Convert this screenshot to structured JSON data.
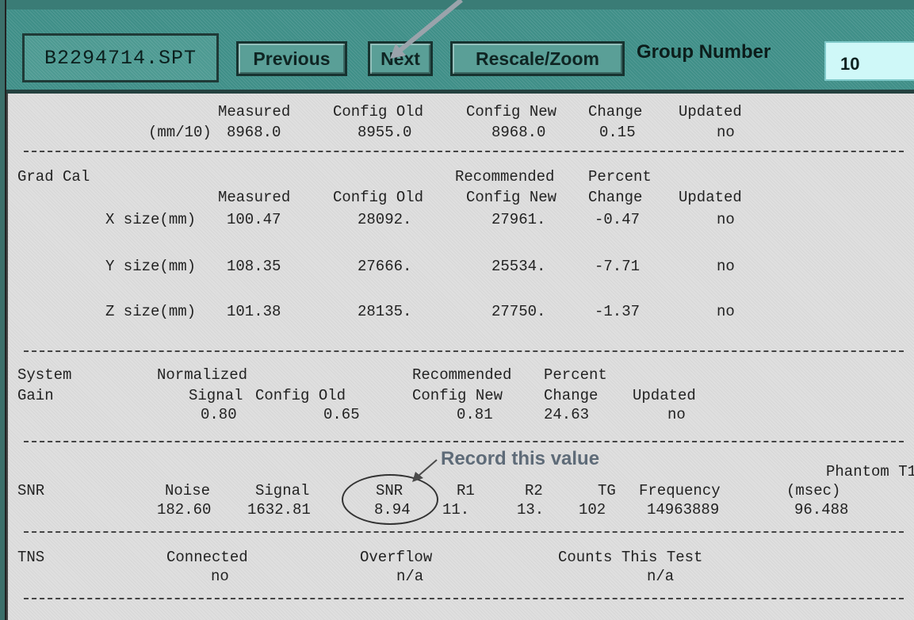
{
  "toolbar": {
    "filename": "B2294714.SPT",
    "previous_label": "Previous",
    "next_label": "Next",
    "rescale_label": "Rescale/Zoom",
    "group_label": "Group Number",
    "group_value": "10"
  },
  "freq": {
    "hdr_measured": "Measured",
    "hdr_config_old": "Config Old",
    "hdr_config_new": "Config New",
    "hdr_change": "Change",
    "hdr_updated": "Updated",
    "unit": "(mm/10)",
    "measured": "8968.0",
    "config_old": "8955.0",
    "config_new": "8968.0",
    "change": "0.15",
    "updated": "no"
  },
  "grad": {
    "title": "Grad Cal",
    "hdr_recommended": "Recommended",
    "hdr_percent": "Percent",
    "hdr_measured": "Measured",
    "hdr_config_old": "Config Old",
    "hdr_config_new": "Config New",
    "hdr_change": "Change",
    "hdr_updated": "Updated",
    "rows": [
      {
        "label": "X size(mm)",
        "measured": "100.47",
        "old": "28092.",
        "new": "27961.",
        "change": "-0.47",
        "updated": "no"
      },
      {
        "label": "Y size(mm)",
        "measured": "108.35",
        "old": "27666.",
        "new": "25534.",
        "change": "-7.71",
        "updated": "no"
      },
      {
        "label": "Z size(mm)",
        "measured": "101.38",
        "old": "28135.",
        "new": "27750.",
        "change": "-1.37",
        "updated": "no"
      }
    ]
  },
  "gain": {
    "title1": "System",
    "title2": "Gain",
    "hdr_normalized": "Normalized",
    "hdr_recommended": "Recommended",
    "hdr_percent": "Percent",
    "hdr_signal": "Signal",
    "hdr_config_old": "Config Old",
    "hdr_config_new": "Config New",
    "hdr_change": "Change",
    "hdr_updated": "Updated",
    "signal": "0.80",
    "config_old": "0.65",
    "config_new": "0.81",
    "change": "24.63",
    "updated": "no"
  },
  "snr": {
    "callout": "Record this value",
    "title": "SNR",
    "hdr_noise": "Noise",
    "hdr_signal": "Signal",
    "hdr_snr": "SNR",
    "hdr_r1": "R1",
    "hdr_r2": "R2",
    "hdr_tg": "TG",
    "hdr_frequency": "Frequency",
    "hdr_phantom": "Phantom T1",
    "hdr_msec": "(msec)",
    "noise": "182.60",
    "signal": "1632.81",
    "snr": "8.94",
    "r1": "11.",
    "r2": "13.",
    "tg": "102",
    "frequency": "14963889",
    "t1": "96.488"
  },
  "tns": {
    "title": "TNS",
    "hdr_connected": "Connected",
    "hdr_overflow": "Overflow",
    "hdr_counts": "Counts This Test",
    "connected": "no",
    "overflow": "n/a",
    "counts": "n/a"
  },
  "colors": {
    "toolbar_teal": "#3f8f88",
    "group_field": "#cff8f8",
    "callout_arrow": "#9aa3ab"
  }
}
